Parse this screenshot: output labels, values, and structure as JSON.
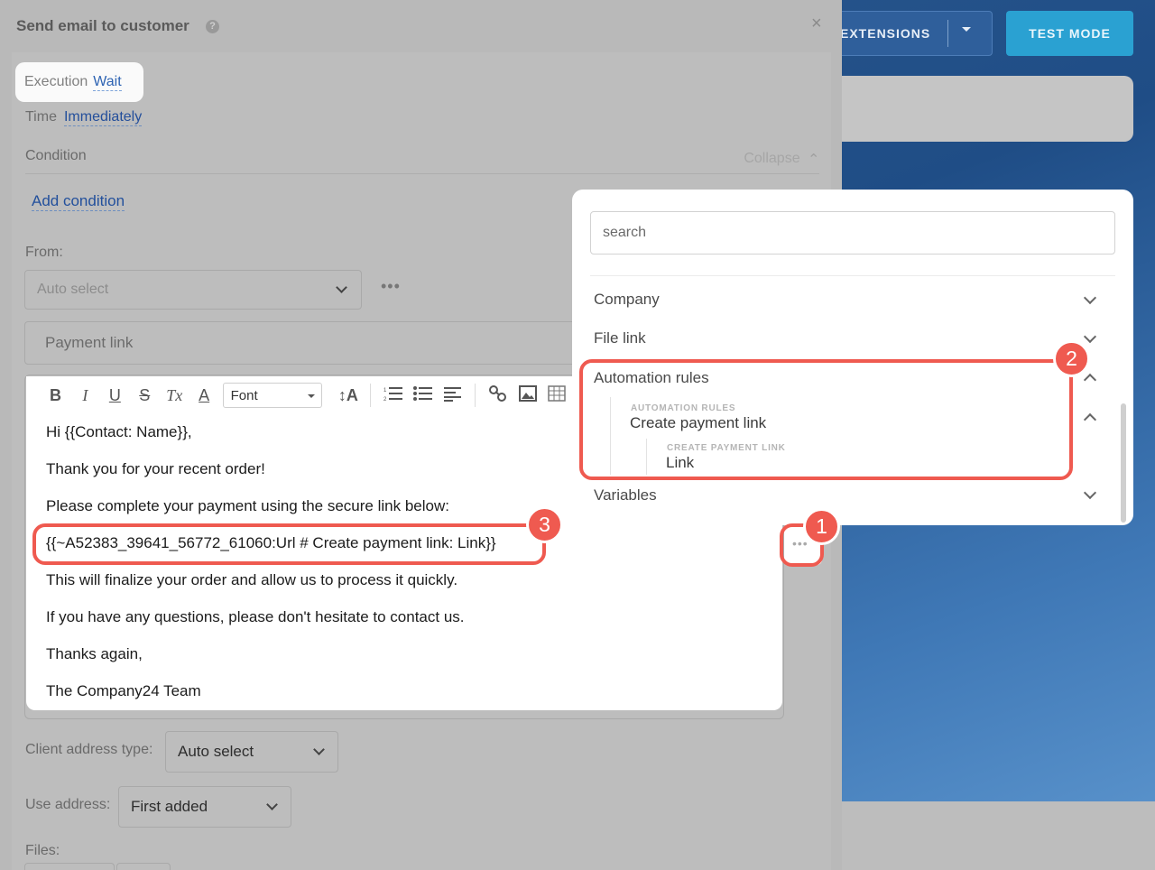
{
  "background": {
    "extensions_label": "EXTENSIONS",
    "test_mode_label": "TEST MODE"
  },
  "panel": {
    "title": "Send email to customer",
    "help_glyph": "?",
    "close_glyph": "×",
    "execution": {
      "label": "Execution",
      "value": "Wait"
    },
    "time": {
      "label": "Time",
      "value": "Immediately"
    },
    "condition": {
      "label": "Condition",
      "collapse": "Collapse",
      "add": "Add condition"
    },
    "from": {
      "label": "From:",
      "value": "Auto select",
      "more": "•••"
    },
    "subject": "Payment link"
  },
  "editor": {
    "toolbar": {
      "bold": "B",
      "italic": "I",
      "underline": "U",
      "strike": "S",
      "clear": "Tx",
      "color": "A",
      "font": "Font",
      "size": "↕A",
      "link": "🔗",
      "image": "▣",
      "table": "▦"
    },
    "lines": [
      "Hi {{Contact: Name}},",
      "Thank you for your recent order!",
      "Please complete your payment using the secure link below:",
      "{{~A52383_39641_56772_61060:Url # Create payment link: Link}}",
      "This will finalize your order and allow us to process it quickly.",
      "If you have any questions, please don't hesitate to contact us.",
      "Thanks again,",
      "The Company24 Team"
    ],
    "more": "•••"
  },
  "lower_form": {
    "client_address_type": {
      "label": "Client address type:",
      "value": "Auto select"
    },
    "use_address": {
      "label": "Use address:",
      "value": "First added"
    },
    "files_label": "Files:"
  },
  "popup": {
    "search_placeholder": "search",
    "categories": [
      {
        "label": "Company",
        "state": "collapsed"
      },
      {
        "label": "File link",
        "state": "collapsed"
      },
      {
        "label": "Automation rules",
        "state": "expanded"
      },
      {
        "label": "Variables",
        "state": "collapsed"
      }
    ],
    "automation_rules": {
      "caption": "AUTOMATION RULES",
      "item": "Create payment link",
      "sub_caption": "CREATE PAYMENT LINK",
      "sub_item": "Link"
    }
  },
  "annotations": {
    "badge_1": "1",
    "badge_2": "2",
    "badge_3": "3",
    "color": "#ef5a50"
  }
}
